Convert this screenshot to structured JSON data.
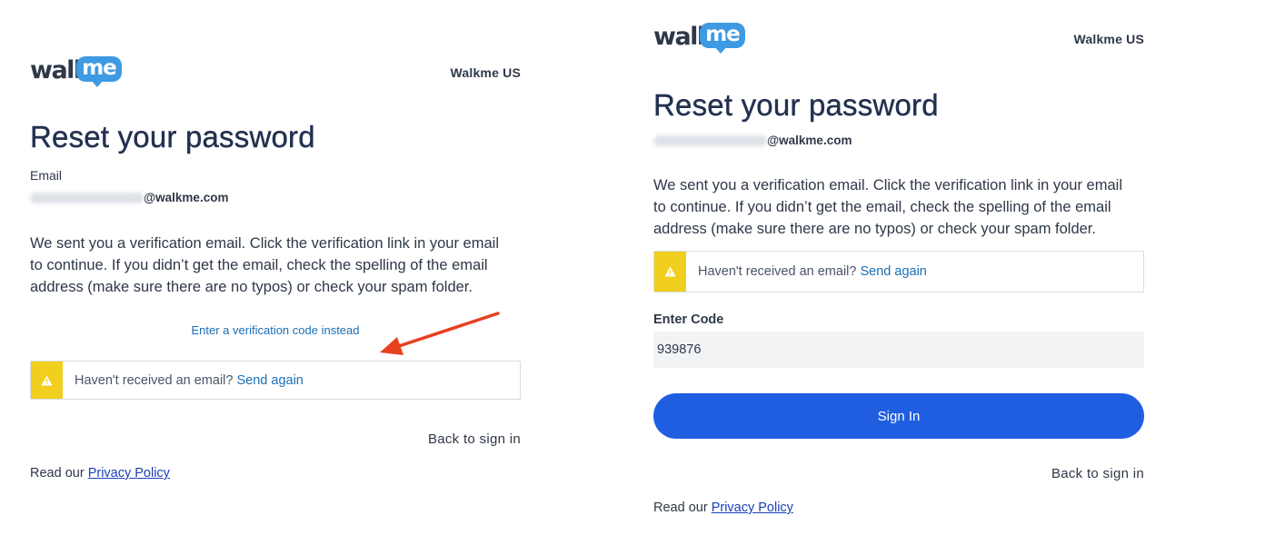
{
  "colors": {
    "title": "#233150",
    "link": "#1a6fb5",
    "primary_button": "#1f5ee0",
    "warning": "#f0cf1e",
    "annotation_arrow": "#e8401f",
    "logo_bubble": "#3e9ae2"
  },
  "left": {
    "logo": {
      "walk": "walk",
      "me": "me"
    },
    "region": "Walkme US",
    "title": "Reset your password",
    "email_label": "Email",
    "email_domain": "@walkme.com",
    "message": "We sent you a verification email. Click the verification link in your email to continue. If you didn’t get the email, check the spelling of the email address (make sure there are no typos) or check your spam folder.",
    "code_link": "Enter a verification code instead",
    "alert": {
      "text": "Haven't received an email?",
      "link": "Send again",
      "icon": "warning-icon"
    },
    "back": "Back to sign in",
    "privacy_prefix": "Read our",
    "privacy_link": "Privacy Policy"
  },
  "right": {
    "logo": {
      "walk": "walk",
      "me": "me"
    },
    "region": "Walkme US",
    "title": "Reset your password",
    "email_domain": "@walkme.com",
    "message": "We sent you a verification email. Click the verification link in your email to continue. If you didn’t get the email, check the spelling of the email address (make sure there are no typos) or check your spam folder.",
    "alert": {
      "text": "Haven't received an email?",
      "link": "Send again",
      "icon": "warning-icon"
    },
    "code_label": "Enter Code",
    "code_value": "939876",
    "signin_label": "Sign In",
    "back": "Back to sign in",
    "privacy_prefix": "Read our",
    "privacy_link": "Privacy Policy"
  }
}
